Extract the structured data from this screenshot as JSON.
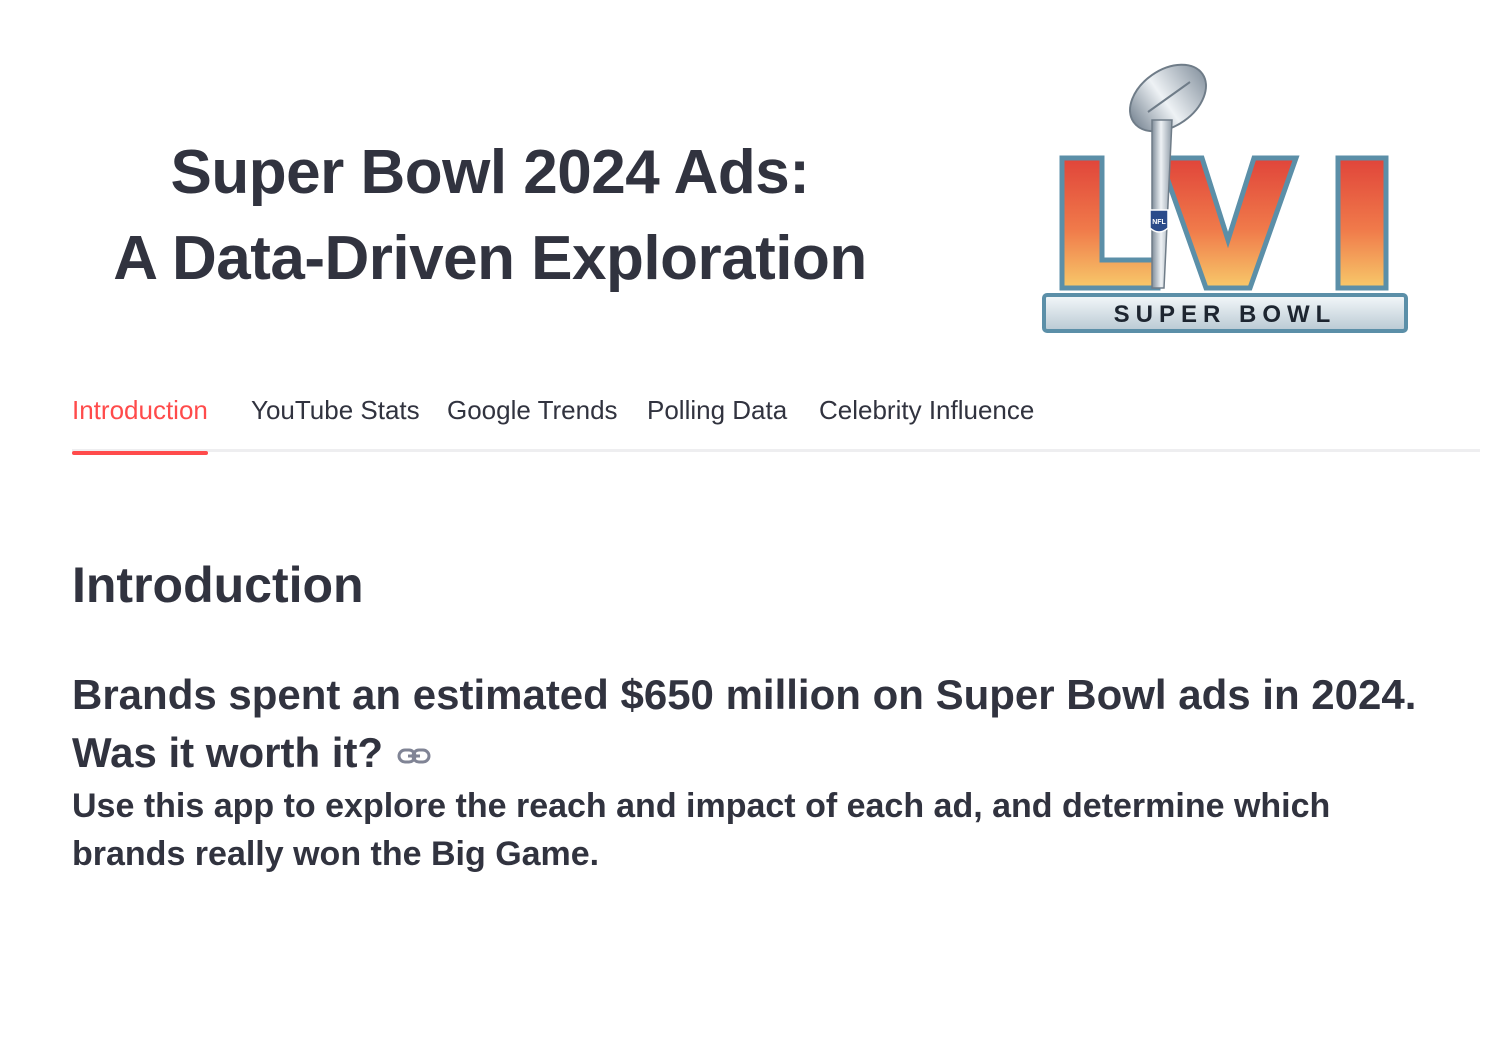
{
  "header": {
    "title_line1": "Super Bowl 2024 Ads:",
    "title_line2": "A Data-Driven Exploration",
    "logo": {
      "icon": "super-bowl-lvi-logo",
      "text": "SUPER BOWL",
      "numeral": "LVI",
      "nfl": "NFL",
      "colors": {
        "numeral_top": "#e0443a",
        "numeral_bottom": "#f7b25a",
        "frame": "#5b8fa8",
        "banner": "#dfe8ee",
        "trophy": "#c8ced6"
      }
    }
  },
  "tabs": [
    {
      "label": "Introduction",
      "active": true
    },
    {
      "label": "YouTube Stats",
      "active": false
    },
    {
      "label": "Google Trends",
      "active": false
    },
    {
      "label": "Polling Data",
      "active": false
    },
    {
      "label": "Celebrity Influence",
      "active": false
    }
  ],
  "content": {
    "section_title": "Introduction",
    "subhead_line1": "Brands spent an estimated $650 million on Super Bowl ads in 2024.",
    "subhead_line2": "Was it worth it?",
    "anchor_icon": "link-icon",
    "body_line1": "Use this app to explore the reach and impact of each ad, and determine which",
    "body_line2": "brands really won the Big Game."
  },
  "colors": {
    "accent": "#ff4b4b",
    "text": "#31333f",
    "divider": "#eeeef0"
  }
}
